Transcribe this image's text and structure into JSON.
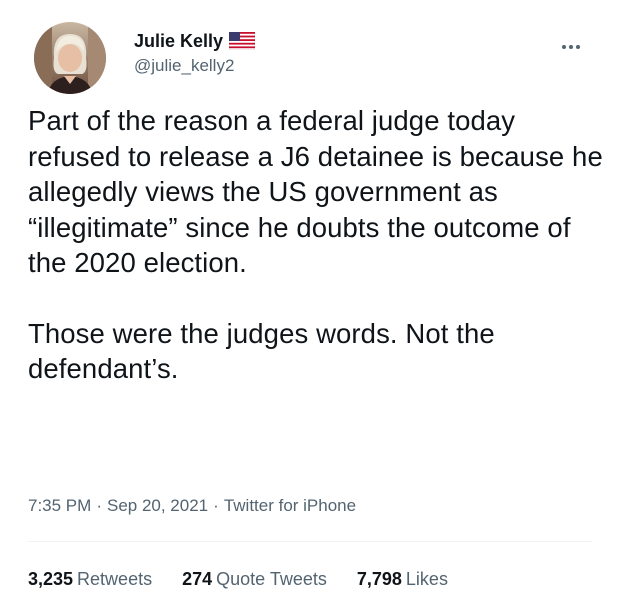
{
  "author": {
    "display_name": "Julie Kelly",
    "handle": "@julie_kelly2",
    "badge_icon": "us-flag-icon"
  },
  "tweet": {
    "paragraphs": [
      "Part of the reason a federal judge today refused to release a J6 detainee is because he allegedly views the US government as “illegitimate” since he doubts the outcome of the 2020 election.",
      "Those were the judges words. Not the defendant’s."
    ],
    "time": "7:35 PM",
    "date": "Sep 20, 2021",
    "source": "Twitter for iPhone",
    "separator": "·"
  },
  "stats": {
    "retweets_count": "3,235",
    "retweets_label": "Retweets",
    "quotes_count": "274",
    "quotes_label": "Quote Tweets",
    "likes_count": "7,798",
    "likes_label": "Likes"
  },
  "colors": {
    "text_primary": "#0f1419",
    "text_secondary": "#536471"
  }
}
